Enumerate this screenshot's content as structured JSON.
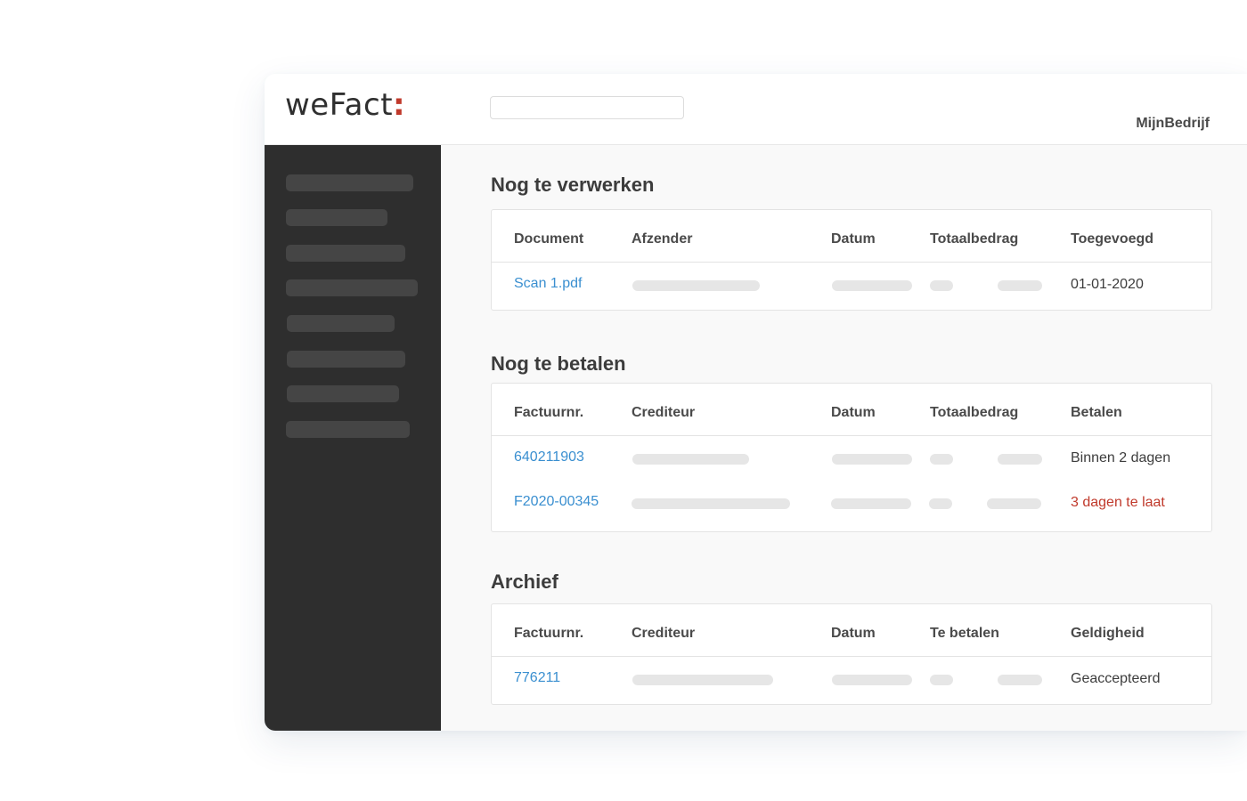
{
  "header": {
    "logo_main": "weFact",
    "logo_colon": ":",
    "search_value": "",
    "search_placeholder": "",
    "company": "MijnBedrijf"
  },
  "sidebar": {
    "item_count": 8
  },
  "sections": {
    "pending": {
      "title": "Nog te verwerken",
      "columns": [
        "Document",
        "Afzender",
        "Datum",
        "Totaalbedrag",
        "Toegevoegd"
      ],
      "rows": [
        {
          "document": "Scan 1.pdf",
          "added": "01-01-2020"
        }
      ]
    },
    "to_pay": {
      "title": "Nog te betalen",
      "columns": [
        "Factuurnr.",
        "Crediteur",
        "Datum",
        "Totaalbedrag",
        "Betalen"
      ],
      "rows": [
        {
          "invoice": "640211903",
          "pay": "Binnen 2 dagen"
        },
        {
          "invoice": "F2020-00345",
          "pay": "3 dagen te laat"
        }
      ]
    },
    "archive": {
      "title": "Archief",
      "columns": [
        "Factuurnr.",
        "Crediteur",
        "Datum",
        "Te betalen",
        "Geldigheid"
      ],
      "rows": [
        {
          "invoice": "776211",
          "validity": "Geaccepteerd"
        }
      ]
    }
  },
  "colors": {
    "link": "#3a8fd0",
    "late": "#c0392b",
    "sidebar": "#2e2e2e",
    "logo_accent": "#c0392b"
  }
}
